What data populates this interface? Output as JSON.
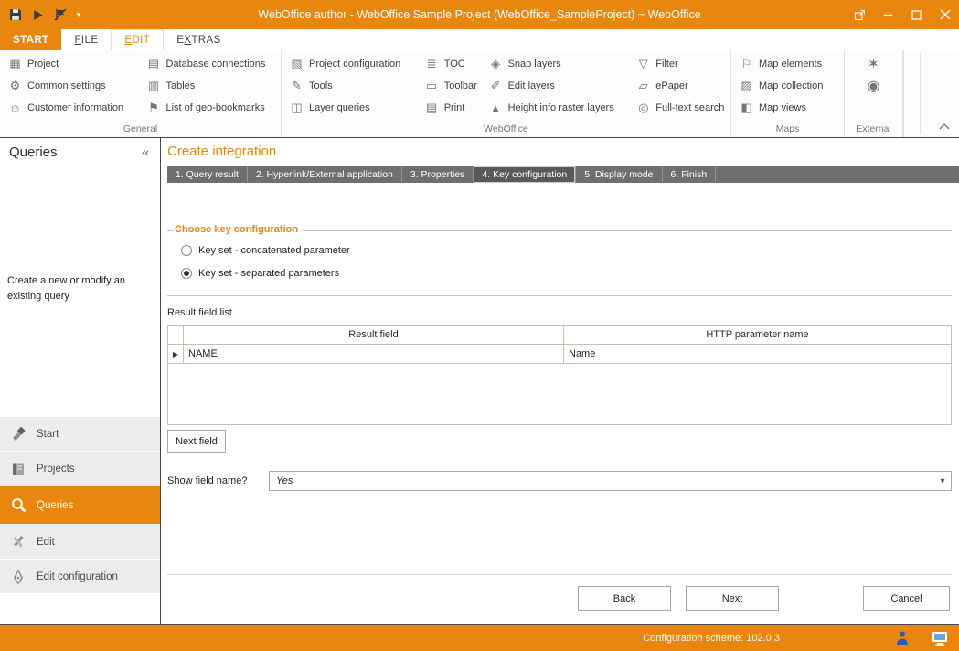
{
  "accent_color": "#e8860d",
  "titlebar": {
    "title": "WebOffice author - WebOffice Sample Project (WebOffice_SampleProject) ~ WebOffice"
  },
  "tabs": [
    {
      "pre": "",
      "u": "",
      "rest": "START",
      "label": "START"
    },
    {
      "pre": "",
      "u": "F",
      "rest": "ILE",
      "label": "FILE"
    },
    {
      "pre": "",
      "u": "E",
      "rest": "DIT",
      "label": "EDIT"
    },
    {
      "pre": "E",
      "u": "X",
      "rest": "TRAS",
      "label": "EXTRAS"
    }
  ],
  "icons": {
    "project": "▦",
    "common_settings": "⚙",
    "customer_information": "☺",
    "database_connections": "▤",
    "tables": "▥",
    "geo_bookmarks": "⚑",
    "project_configuration": "▧",
    "tools": "✎",
    "layer_queries": "◫",
    "toc": "≣",
    "toolbar": "▭",
    "print": "▤",
    "snap_layers": "◈",
    "edit_layers": "✐",
    "height_info": "▲",
    "filter": "▽",
    "epaper": "▱",
    "full_text_search": "◎",
    "map_elements": "⚐",
    "map_collection": "▨",
    "map_views": "◧",
    "pin": "✶",
    "search_location": "◉",
    "collapse_sidebar": "«",
    "dropdown_arrow": "▾",
    "row_selector": "▶"
  },
  "ribbon": {
    "general": {
      "label": "General",
      "col1": [
        "Project",
        "Common settings",
        "Customer information"
      ],
      "col2": [
        "Database connections",
        "Tables",
        "List of geo-bookmarks"
      ]
    },
    "weboffice": {
      "label": "WebOffice",
      "col1": [
        "Project configuration",
        "Tools",
        "Layer queries"
      ],
      "col2": [
        "TOC",
        "Toolbar",
        "Print"
      ],
      "col3": [
        "Snap layers",
        "Edit layers",
        "Height info raster layers"
      ],
      "col4": [
        "Filter",
        "ePaper",
        "Full-text search"
      ]
    },
    "maps": {
      "label": "Maps",
      "col1": [
        "Map elements",
        "Map collection",
        "Map views"
      ]
    },
    "external": {
      "label": "External"
    }
  },
  "sidebar": {
    "header": "Queries",
    "description": "Create a new or modify an existing query",
    "nav": [
      {
        "label": "Start",
        "active": false
      },
      {
        "label": "Projects",
        "active": false
      },
      {
        "label": "Queries",
        "active": true
      },
      {
        "label": "Edit",
        "active": false
      },
      {
        "label": "Edit configuration",
        "active": false
      }
    ]
  },
  "main": {
    "title": "Create integration",
    "wizard": {
      "active_index": 3,
      "steps": [
        "1. Query result",
        "2. Hyperlink/External application",
        "3. Properties",
        "4. Key configuration",
        "5. Display mode",
        "6. Finish"
      ]
    },
    "key_config": {
      "group_label": "Choose key configuration",
      "options": [
        {
          "label": "Key set - concatenated parameter",
          "selected": false
        },
        {
          "label": "Key set - separated parameters",
          "selected": true
        }
      ]
    },
    "result_fields": {
      "label": "Result field list",
      "columns": [
        "Result field",
        "HTTP parameter name"
      ],
      "rows": [
        {
          "result_field": "NAME",
          "http_parameter_name": "Name"
        }
      ]
    },
    "next_field_button": "Next field",
    "show_field_name": {
      "label": "Show field name?",
      "value": "Yes"
    },
    "footer": {
      "back": "Back",
      "next": "Next",
      "cancel": "Cancel"
    }
  },
  "statusbar": {
    "text": "Configuration scheme:  102.0.3"
  }
}
